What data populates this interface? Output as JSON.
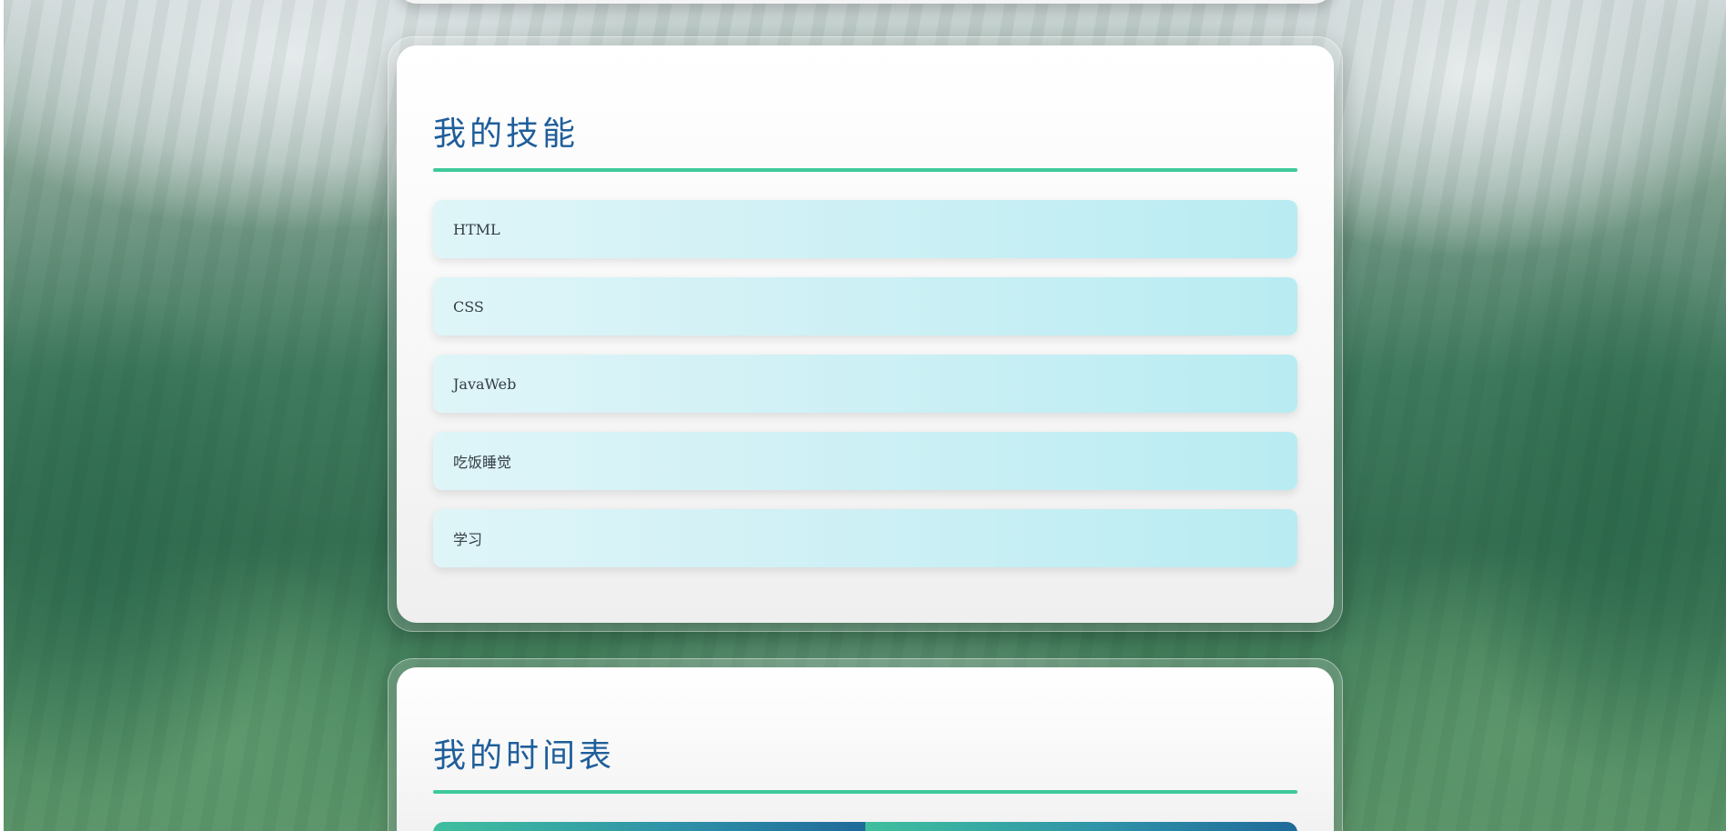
{
  "skills_section": {
    "title": "我的技能",
    "items": [
      {
        "label": "HTML"
      },
      {
        "label": "CSS"
      },
      {
        "label": "JavaWeb"
      },
      {
        "label": "吃饭睡觉"
      },
      {
        "label": "学习"
      }
    ]
  },
  "schedule_section": {
    "title": "我的时间表"
  },
  "colors": {
    "title": "#1f5e9a",
    "accent_line": "#3fc99a",
    "skill_bg": "#cdf0f5"
  }
}
